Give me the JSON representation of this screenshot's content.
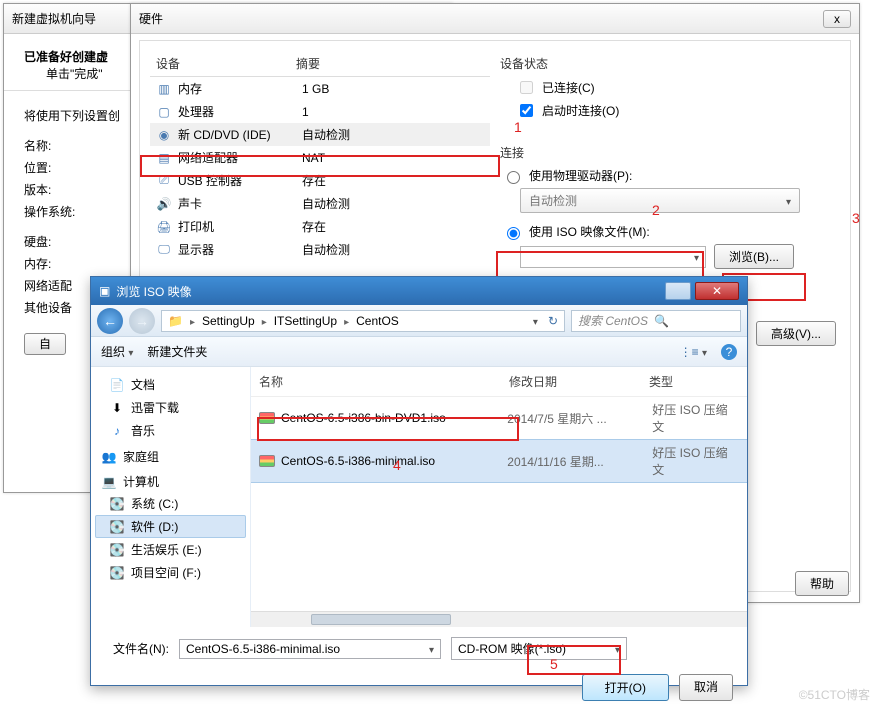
{
  "wizard": {
    "title": "新建虚拟机向导",
    "head_bold": "已准备好创建虚",
    "head_sub": "单击\"完成\"",
    "intro": "将使用下列设置创",
    "labels": {
      "name": "名称:",
      "loc": "位置:",
      "ver": "版本:",
      "os": "操作系统:",
      "hd": "硬盘:",
      "mem": "内存:",
      "net": "网络适配",
      "other": "其他设备"
    },
    "custom_btn": "自"
  },
  "hw": {
    "title": "硬件",
    "close": "x",
    "col_dev": "设备",
    "col_sum": "摘要",
    "rows": [
      {
        "ic": "mem",
        "n": "内存",
        "s": "1 GB"
      },
      {
        "ic": "cpu",
        "n": "处理器",
        "s": "1"
      },
      {
        "ic": "cd",
        "n": "新 CD/DVD (IDE)",
        "s": "自动检测",
        "sel": true
      },
      {
        "ic": "net",
        "n": "网络适配器",
        "s": "NAT"
      },
      {
        "ic": "usb",
        "n": "USB 控制器",
        "s": "存在"
      },
      {
        "ic": "snd",
        "n": "声卡",
        "s": "自动检测"
      },
      {
        "ic": "prn",
        "n": "打印机",
        "s": "存在"
      },
      {
        "ic": "dsp",
        "n": "显示器",
        "s": "自动检测"
      }
    ],
    "status_title": "设备状态",
    "connected": "已连接(C)",
    "connect_on": "启动时连接(O)",
    "conn_title": "连接",
    "use_phys": "使用物理驱动器(P):",
    "auto_detect": "自动检测",
    "use_iso": "使用 ISO 映像文件(M):",
    "browse_btn": "浏览(B)...",
    "adv_btn": "高级(V)...",
    "help_btn": "帮助"
  },
  "ann": {
    "a1": "1",
    "a2": "2",
    "a3": "3",
    "a4": "4",
    "a5": "5"
  },
  "browse": {
    "title": "浏览 ISO 映像",
    "crumbs": [
      "SettingUp",
      "ITSettingUp",
      "CentOS"
    ],
    "search_ph": "搜索 CentOS",
    "organize": "组织",
    "newfolder": "新建文件夹",
    "side": {
      "docs": "文档",
      "xl": "迅雷下载",
      "music": "音乐",
      "home": "家庭组",
      "computer": "计算机",
      "cdrive": "系统 (C:)",
      "ddrive": "软件 (D:)",
      "edrive": "生活娱乐 (E:)",
      "fdrive": "项目空间 (F:)"
    },
    "col_name": "名称",
    "col_date": "修改日期",
    "col_type": "类型",
    "files": [
      {
        "n": "CentOS-6.5-i386-bin-DVD1.iso",
        "d": "2014/7/5 星期六 ...",
        "t": "好压 ISO 压缩文"
      },
      {
        "n": "CentOS-6.5-i386-minimal.iso",
        "d": "2014/11/16 星期...",
        "t": "好压 ISO 压缩文",
        "sel": true
      }
    ],
    "fname_label": "文件名(N):",
    "fname_value": "CentOS-6.5-i386-minimal.iso",
    "filter": "CD-ROM 映像(*.iso)",
    "open": "打开(O)",
    "cancel": "取消"
  },
  "watermark": "©51CTO博客"
}
